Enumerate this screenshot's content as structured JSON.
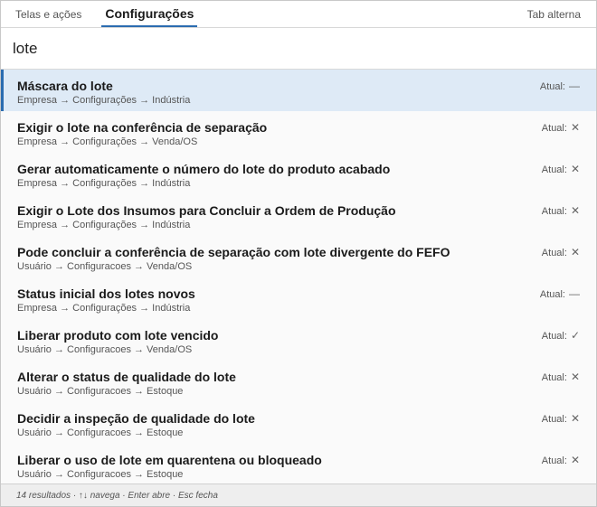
{
  "tabs": {
    "left": "Telas e ações",
    "active": "Configurações",
    "right": "Tab alterna"
  },
  "search": {
    "value": "lote"
  },
  "status_prefix": "Atual:",
  "items": [
    {
      "title": "Máscara do lote",
      "path": "Empresa → Configurações → Indústria",
      "status": "—",
      "selected": true
    },
    {
      "title": "Exigir o lote na conferência de separação",
      "path": "Empresa → Configurações → Venda/OS",
      "status": "✕"
    },
    {
      "title": "Gerar automaticamente o número do lote do produto acabado",
      "path": "Empresa → Configurações → Indústria",
      "status": "✕"
    },
    {
      "title": "Exigir o Lote dos Insumos para Concluir a Ordem de Produção",
      "path": "Empresa → Configurações → Indústria",
      "status": "✕"
    },
    {
      "title": "Pode concluir a conferência de separação com lote divergente do FEFO",
      "path": "Usuário → Configuracoes → Venda/OS",
      "status": "✕"
    },
    {
      "title": "Status inicial dos lotes novos",
      "path": "Empresa → Configurações → Indústria",
      "status": "—"
    },
    {
      "title": "Liberar produto com lote vencido",
      "path": "Usuário → Configuracoes → Venda/OS",
      "status": "✓"
    },
    {
      "title": "Alterar o status de qualidade do lote",
      "path": "Usuário → Configuracoes → Estoque",
      "status": "✕"
    },
    {
      "title": "Decidir a inspeção de qualidade do lote",
      "path": "Usuário → Configuracoes → Estoque",
      "status": "✕"
    },
    {
      "title": "Liberar o uso de lote em quarentena ou bloqueado",
      "path": "Usuário → Configuracoes → Estoque",
      "status": "✕"
    }
  ],
  "footer": {
    "text": "14 resultados  ·  ↑↓ navega  ·  Enter abre  ·  Esc fecha"
  }
}
